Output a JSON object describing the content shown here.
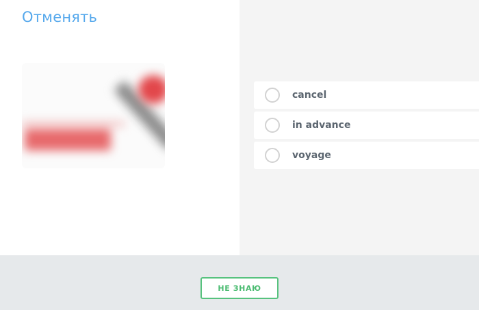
{
  "question": {
    "word": "Отменять",
    "image_icon": "blurred-illustration"
  },
  "answers": [
    {
      "label": "cancel"
    },
    {
      "label": "in advance"
    },
    {
      "label": "voyage"
    }
  ],
  "footer": {
    "dont_know_label": "НЕ ЗНАЮ"
  },
  "colors": {
    "word": "#55a8ec",
    "accent_green": "#57c27e",
    "right_panel_bg": "#f4f4f4",
    "footer_bg": "#e6e9eb"
  }
}
